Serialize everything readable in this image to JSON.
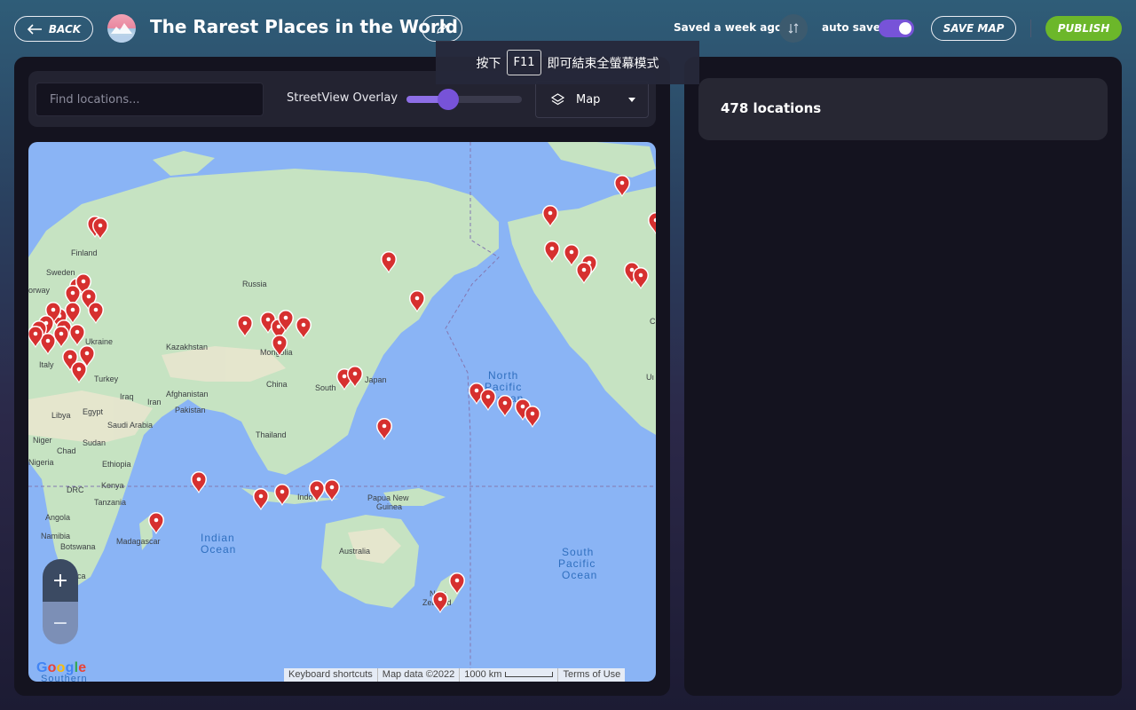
{
  "header": {
    "back_label": "BACK",
    "title": "The Rarest Places in the World",
    "saved_status": "Saved a week ago",
    "autosave_label": "auto save",
    "autosave_on": true,
    "save_map_label": "SAVE MAP",
    "publish_label": "PUBLISH"
  },
  "toolbar": {
    "search_placeholder": "Find locations...",
    "overlay_label": "StreetView Overlay",
    "overlay_slider_value": 0.36,
    "map_type_label": "Map"
  },
  "map": {
    "zoom_in": "+",
    "zoom_out": "−",
    "labels": {
      "finland": "Finland",
      "sweden": "Sweden",
      "norway": "orway",
      "russia": "Russia",
      "ukraine": "Ukraine",
      "kazakhstan": "Kazakhstan",
      "mongolia": "Mongolia",
      "italy": "Italy",
      "turkey": "Turkey",
      "china": "China",
      "south_korea": "South",
      "japan": "Japan",
      "afghanistan": "Afghanistan",
      "iraq": "Iraq",
      "iran": "Iran",
      "pakistan": "Pakistan",
      "libya": "Libya",
      "egypt": "Egypt",
      "saudi": "Saudi Arabia",
      "thailand": "Thailand",
      "niger": "Niger",
      "chad": "Chad",
      "sudan": "Sudan",
      "nigeria": "Nigeria",
      "ethiopia": "Ethiopia",
      "drc": "DRC",
      "kenya": "Kenya",
      "tanzania": "Tanzania",
      "angola": "Angola",
      "namibia": "Namibia",
      "botswana": "Botswana",
      "madagascar": "Madagascar",
      "south_africa": "South Africa",
      "indian_ocean_1": "Indian",
      "indian_ocean_2": "Ocean",
      "north_pacific_1": "North",
      "north_pacific_2": "Pacific",
      "north_pacific_3": "Ocean",
      "south_pacific_1": "South",
      "south_pacific_2": "Pacific",
      "south_pacific_3": "Ocean",
      "indonesia": "Indo",
      "papua_1": "Papua New",
      "papua_2": "Guinea",
      "australia": "Australia",
      "nz_1": "New",
      "nz_2": "Zealand",
      "canada_c": "C",
      "us_u": "Uı",
      "southern": "Southern"
    },
    "attribution": {
      "shortcuts": "Keyboard shortcuts",
      "data": "Map data ©2022",
      "scale": "1000 km",
      "terms": "Terms of Use"
    },
    "google_logo": [
      "G",
      "o",
      "o",
      "g",
      "l",
      "e"
    ]
  },
  "side_panel": {
    "location_count": "478 locations"
  },
  "fullscreen_toast": {
    "prefix": "按下",
    "key": "F11",
    "suffix": "即可結束全螢幕模式"
  },
  "colors": {
    "accent": "#7753d8",
    "publish": "#6cb72a",
    "pin": "#d6302f",
    "panel": "#14131f",
    "water": "#8ab4f5",
    "land": "#c6e3c2"
  }
}
